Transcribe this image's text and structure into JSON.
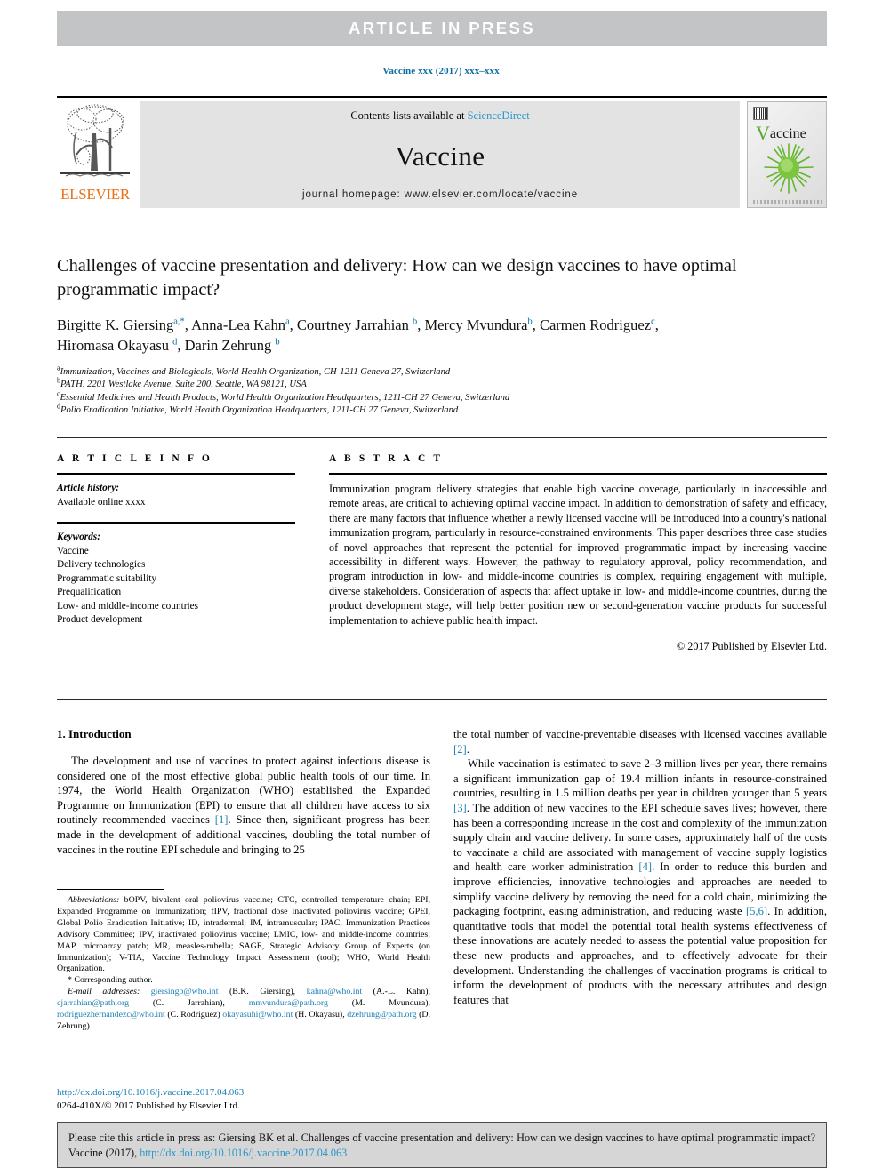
{
  "banner": {
    "text": "ARTICLE IN PRESS"
  },
  "running_head": {
    "text": "Vaccine xxx (2017) xxx–xxx"
  },
  "masthead": {
    "contents_prefix": "Contents lists available at ",
    "sciencedirect": "ScienceDirect",
    "journal_name": "Vaccine",
    "homepage": "journal homepage: www.elsevier.com/locate/vaccine",
    "publisher": "ELSEVIER",
    "cover_v": "V",
    "cover_accine": "accine"
  },
  "article": {
    "title": "Challenges of vaccine presentation and delivery: How can we design vaccines to have optimal programmatic impact?",
    "authors_line1_p1": "Birgitte K. Giersing",
    "authors_line1_s1": "a,*",
    "authors_line1_p2": ", Anna-Lea Kahn",
    "authors_line1_s2": "a",
    "authors_line1_p3": ", Courtney Jarrahian ",
    "authors_line1_s3": "b",
    "authors_line1_p4": ", Mercy Mvundura",
    "authors_line1_s4": "b",
    "authors_line1_p5": ", Carmen Rodriguez",
    "authors_line1_s5": "c",
    "authors_line1_p6": ",",
    "authors_line2_p1": "Hiromasa Okayasu ",
    "authors_line2_s1": "d",
    "authors_line2_p2": ", Darin Zehrung ",
    "authors_line2_s2": "b",
    "affiliations": [
      {
        "mark": "a",
        "text": "Immunization, Vaccines and Biologicals, World Health Organization, CH-1211 Geneva 27, Switzerland"
      },
      {
        "mark": "b",
        "text": "PATH, 2201 Westlake Avenue, Suite 200, Seattle, WA 98121, USA"
      },
      {
        "mark": "c",
        "text": "Essential Medicines and Health Products, World Health Organization Headquarters, 1211-CH 27 Geneva, Switzerland"
      },
      {
        "mark": "d",
        "text": "Polio Eradication Initiative, World Health Organization Headquarters, 1211-CH 27 Geneva, Switzerland"
      }
    ]
  },
  "article_info": {
    "heading": "A R T I C L E   I N F O",
    "history_label": "Article history:",
    "history_value": "Available online xxxx",
    "keywords_label": "Keywords:",
    "keywords": [
      "Vaccine",
      "Delivery technologies",
      "Programmatic suitability",
      "Prequalification",
      "Low- and middle-income countries",
      "Product development"
    ]
  },
  "abstract": {
    "heading": "A B S T R A C T",
    "body": "Immunization program delivery strategies that enable high vaccine coverage, particularly in inaccessible and remote areas, are critical to achieving optimal vaccine impact. In addition to demonstration of safety and efficacy, there are many factors that influence whether a newly licensed vaccine will be introduced into a country's national immunization program, particularly in resource-constrained environments. This paper describes three case studies of novel approaches that represent the potential for improved programmatic impact by increasing vaccine accessibility in different ways. However, the pathway to regulatory approval, policy recommendation, and program introduction in low- and middle-income countries is complex, requiring engagement with multiple, diverse stakeholders. Consideration of aspects that affect uptake in low- and middle-income countries, during the product development stage, will help better position new or second-generation vaccine products for successful implementation to achieve public health impact.",
    "copyright": "© 2017 Published by Elsevier Ltd."
  },
  "introduction": {
    "heading": "1. Introduction",
    "left_para1_a": "The development and use of vaccines to protect against infectious disease is considered one of the most effective global public health tools of our time. In 1974, the World Health Organization (WHO) established the Expanded Programme on Immunization (EPI) to ensure that all children have access to six routinely recommended vaccines ",
    "left_ref1": "[1]",
    "left_para1_b": ". Since then, significant progress has been made in the development of additional vaccines, doubling the total number of vaccines in the routine EPI schedule and bringing to 25",
    "right_para1_a": "the total number of vaccine-preventable diseases with licensed vaccines available ",
    "right_ref2": "[2]",
    "right_para1_b": ".",
    "right_para2_a": "While vaccination is estimated to save 2–3 million lives per year, there remains a significant immunization gap of 19.4 million infants in resource-constrained countries, resulting in 1.5 million deaths per year in children younger than 5 years ",
    "right_ref3": "[3]",
    "right_para2_b": ". The addition of new vaccines to the EPI schedule saves lives; however, there has been a corresponding increase in the cost and complexity of the immunization supply chain and vaccine delivery. In some cases, approximately half of the costs to vaccinate a child are associated with management of vaccine supply logistics and health care worker administration ",
    "right_ref4": "[4]",
    "right_para2_c": ". In order to reduce this burden and improve efficiencies, innovative technologies and approaches are needed to simplify vaccine delivery by removing the need for a cold chain, minimizing the packaging footprint, easing administration, and reducing waste ",
    "right_ref5": "[5,6]",
    "right_para2_d": ". In addition, quantitative tools that model the potential total health systems effectiveness of these innovations are acutely needed to assess the potential value proposition for these new products and approaches, and to effectively advocate for their development. Understanding the challenges of vaccination programs is critical to inform the development of products with the necessary attributes and design features that"
  },
  "footnotes": {
    "abbrev_label": "Abbreviations:",
    "abbrev_text": " bOPV, bivalent oral poliovirus vaccine; CTC, controlled temperature chain; EPI, Expanded Programme on Immunization; fIPV, fractional dose inactivated poliovirus vaccine; GPEI, Global Polio Eradication Initiative; ID, intradermal; IM, intramuscular; IPAC, Immunization Practices Advisory Committee; IPV, inactivated poliovirus vaccine; LMIC, low- and middle-income countries; MAP, microarray patch; MR, measles-rubella; SAGE, Strategic Advisory Group of Experts (on Immunization); V-TIA, Vaccine Technology Impact Assessment (tool); WHO, World Health Organization.",
    "corresponding": "* Corresponding author.",
    "email_label": "E-mail addresses:",
    "emails": [
      {
        "addr": "giersingb@who.int",
        "name": " (B.K. Giersing), "
      },
      {
        "addr": "kahna@who.int",
        "name": " (A.-L. Kahn), "
      },
      {
        "addr": "cjarrahian@path.org",
        "name": " (C. Jarrahian), "
      },
      {
        "addr": "mmvundura@path.org",
        "name": " (M. Mvundura), "
      },
      {
        "addr": "rodriguezhernandezc@who.int",
        "name": " (C. Rodriguez) "
      },
      {
        "addr": "okayasuhi@who.int",
        "name": " (H. Okayasu), "
      },
      {
        "addr": "dzehrung@path.org",
        "name": " (D. Zehrung)."
      }
    ],
    "doi": "http://dx.doi.org/10.1016/j.vaccine.2017.04.063",
    "issn": "0264-410X/© 2017 Published by Elsevier Ltd."
  },
  "citation_footer": {
    "text_a": "Please cite this article in press as: Giersing BK et al. Challenges of vaccine presentation and delivery: How can we design vaccines to have optimal programmatic impact? Vaccine (2017), ",
    "link": "http://dx.doi.org/10.1016/j.vaccine.2017.04.063"
  },
  "colors": {
    "banner_gray": "#c3c4c6",
    "link_blue": "#2a96cc",
    "ref_blue": "#1b7fb4",
    "elsevier_orange": "#eb7116",
    "footer_gray": "#d6d6d6"
  }
}
